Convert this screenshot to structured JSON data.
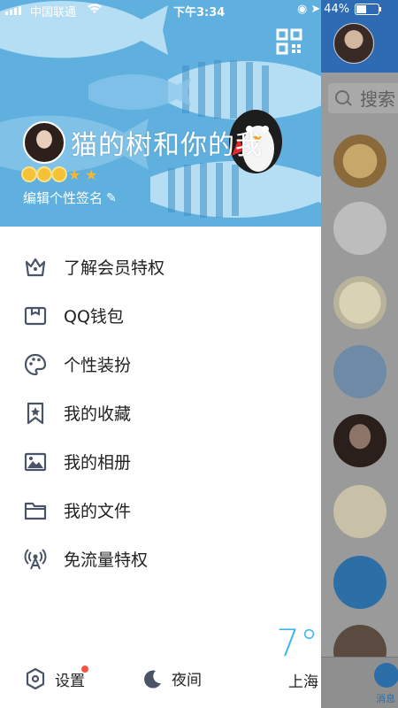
{
  "status_bar": {
    "carrier": "中国联通",
    "time": "下午3:34",
    "battery_percent": "44%",
    "battery_level": 0.44,
    "signal_bars": 4,
    "wifi_icon": "wifi-icon",
    "location_icon": "location-arrow-icon",
    "lock_icon": "orientation-lock-icon"
  },
  "profile": {
    "nickname": "猫的树和你的我",
    "signature": "编辑个性签名",
    "level_icons": [
      "sun",
      "sun",
      "sun",
      "star",
      "star"
    ],
    "qr_icon": "qr-code-icon"
  },
  "menu": [
    {
      "label": "了解会员特权",
      "icon": "crown-icon"
    },
    {
      "label": "QQ钱包",
      "icon": "wallet-icon"
    },
    {
      "label": "个性装扮",
      "icon": "palette-icon"
    },
    {
      "label": "我的收藏",
      "icon": "bookmark-star-icon"
    },
    {
      "label": "我的相册",
      "icon": "photo-icon"
    },
    {
      "label": "我的文件",
      "icon": "folder-icon"
    },
    {
      "label": "免流量特权",
      "icon": "antenna-icon"
    }
  ],
  "bottom": {
    "settings_label": "设置",
    "night_label": "夜间",
    "has_notification_dot": true
  },
  "weather": {
    "temperature": "7°",
    "city": "上海"
  },
  "background_app": {
    "search_placeholder": "搜索",
    "tab_label": "消息"
  },
  "colors": {
    "accent": "#3fb6f2",
    "header_blue": "#5fb0df",
    "notification": "#f25643",
    "icon_gray": "#4a5466"
  }
}
